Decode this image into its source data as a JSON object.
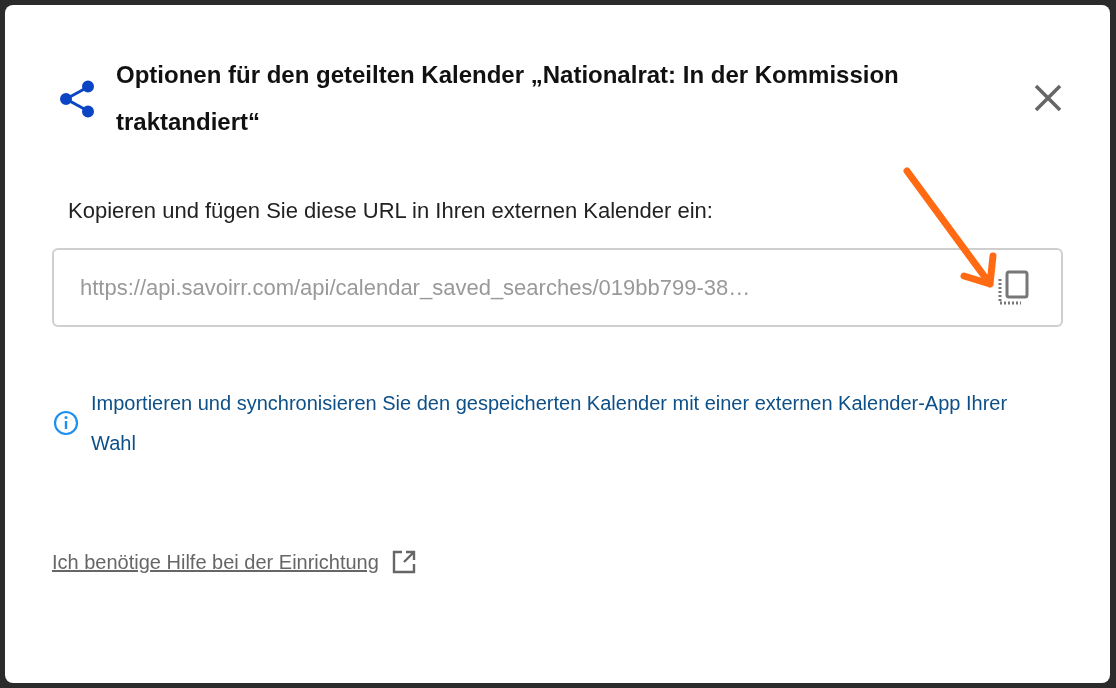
{
  "dialog": {
    "title": "Optionen für den geteilten Kalender „Nationalrat: In der Kommission traktandiert“"
  },
  "url_label": "Kopieren und fügen Sie diese URL in Ihren externen Kalender ein:",
  "url_field": {
    "value": "https://api.savoirr.com/api/calendar_saved_searches/019bb799-38…"
  },
  "info": "Importieren und synchronisieren Sie den gespeicherten Kalender mit einer externen Kalender-App Ihrer Wahl",
  "help_link": "Ich benötige Hilfe bei der Einrichtung"
}
